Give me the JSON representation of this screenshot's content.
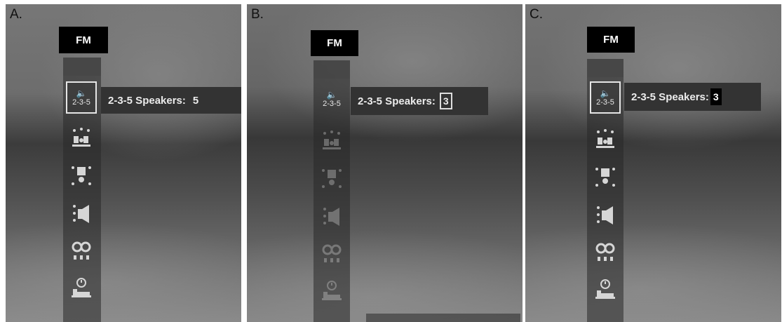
{
  "panels": [
    {
      "label": "A.",
      "fm": "FM",
      "selected_item": "2-3-5",
      "tooltip": {
        "text": "2-3-5 Speakers:",
        "value": "5"
      }
    },
    {
      "label": "B.",
      "fm": "FM",
      "selected_item": "2-3-5",
      "tooltip": {
        "text": "2-3-5 Speakers:",
        "value": "3"
      }
    },
    {
      "label": "C.",
      "fm": "FM",
      "selected_item": "2-3-5",
      "tooltip": {
        "text": "2-3-5 Speakers:",
        "value": "3"
      }
    }
  ],
  "menu_icons": [
    "speaker-mode-235-icon",
    "speaker-array-icon",
    "surround-center-icon",
    "speaker-position-icon",
    "loop-eq-icon",
    "timer-sleep-icon"
  ],
  "colors": {
    "badge_bg": "#000000",
    "badge_text": "#ffffff",
    "tooltip_bg": "#333333",
    "tooltip_text": "#ececec"
  }
}
